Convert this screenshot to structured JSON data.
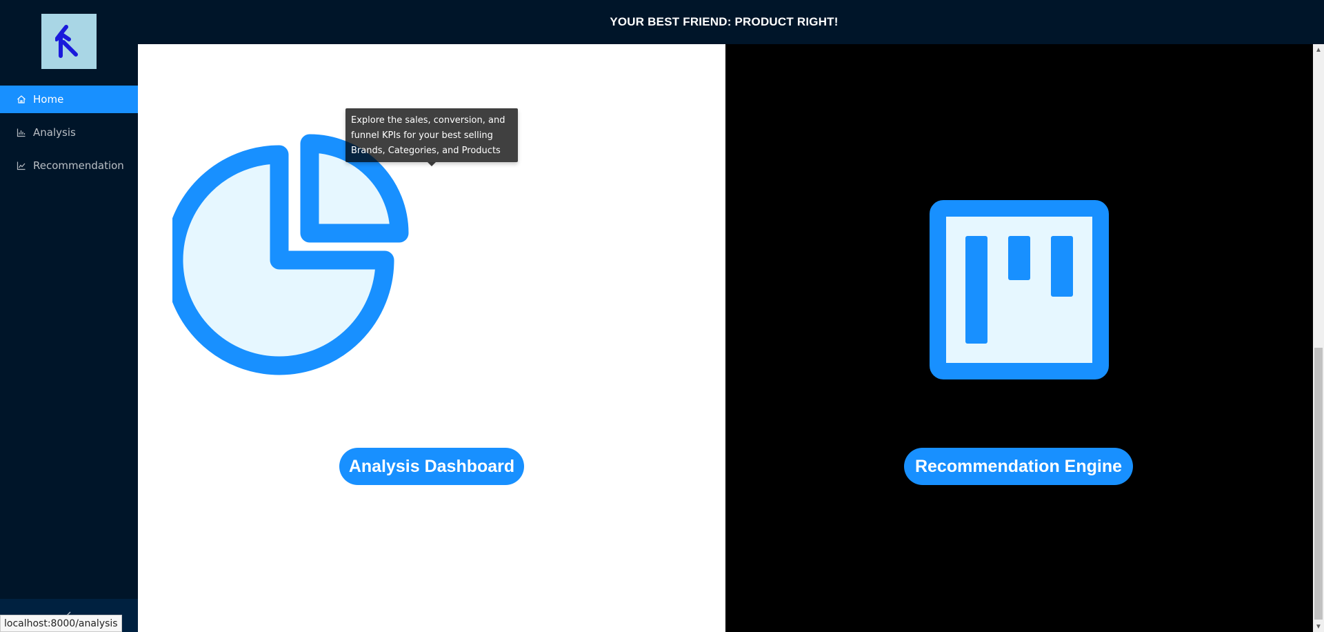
{
  "header": {
    "title": "YOUR BEST FRIEND: PRODUCT RIGHT!"
  },
  "sidebar": {
    "logo_icon": "arrow-logo-icon",
    "items": [
      {
        "label": "Home",
        "icon": "home-icon",
        "active": true
      },
      {
        "label": "Analysis",
        "icon": "bar-chart-icon",
        "active": false
      },
      {
        "label": "Recommendation",
        "icon": "line-chart-icon",
        "active": false
      }
    ],
    "collapse_icon": "chevron-left-icon"
  },
  "main": {
    "analysis": {
      "icon": "pie-chart-icon",
      "button_label": "Analysis Dashboard",
      "tooltip": "Explore the sales, conversion, and funnel KPIs for your best selling Brands, Categories, and Products"
    },
    "recommendation": {
      "icon": "project-board-icon",
      "button_label": "Recommendation Engine"
    }
  },
  "statusbar": {
    "url": "localhost:8000/analysis"
  },
  "colors": {
    "sidebar_bg": "#001529",
    "accent": "#1890ff",
    "logo_bg": "#a9d6e5",
    "icon_fill": "#e6f7ff"
  }
}
